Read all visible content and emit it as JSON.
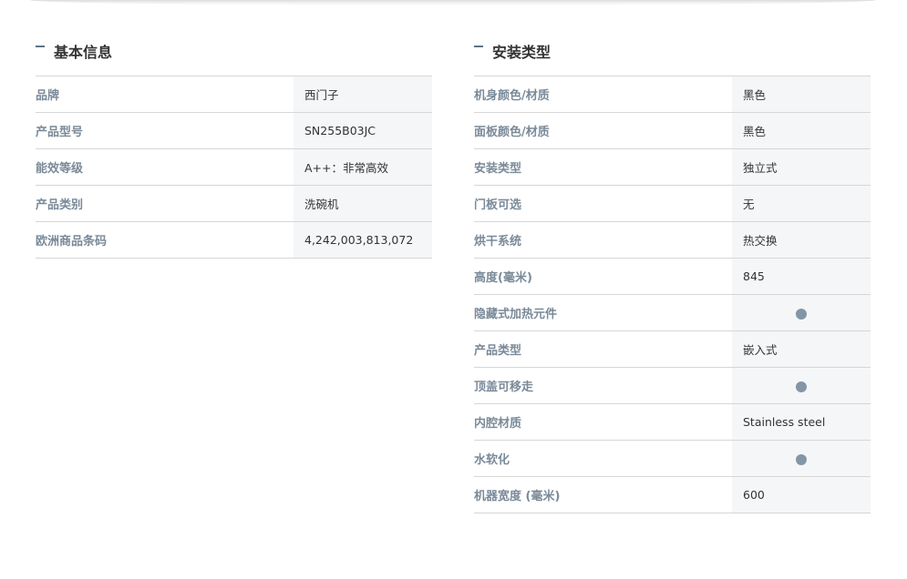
{
  "left": {
    "title": "基本信息",
    "rows": [
      {
        "label": "品牌",
        "value": "西门子"
      },
      {
        "label": "产品型号",
        "value": "SN255B03JC"
      },
      {
        "label": "能效等级",
        "value": "A++：非常高效"
      },
      {
        "label": "产品类别",
        "value": "洗碗机"
      },
      {
        "label": "欧洲商品条码",
        "value": "4,242,003,813,072"
      }
    ]
  },
  "right": {
    "title": "安装类型",
    "rows": [
      {
        "label": "机身颜色/材质",
        "value": "黑色"
      },
      {
        "label": "面板颜色/材质",
        "value": "黑色"
      },
      {
        "label": "安装类型",
        "value": "独立式"
      },
      {
        "label": "门板可选",
        "value": "无"
      },
      {
        "label": "烘干系统",
        "value": "热交换"
      },
      {
        "label": "高度(毫米)",
        "value": "845"
      },
      {
        "label": "隐藏式加热元件",
        "value": null,
        "icon": "dot-indicator-icon"
      },
      {
        "label": "产品类型",
        "value": "嵌入式"
      },
      {
        "label": "顶盖可移走",
        "value": null,
        "icon": "dot-indicator-icon"
      },
      {
        "label": "内腔材质",
        "value": "Stainless steel"
      },
      {
        "label": "水软化",
        "value": null,
        "icon": "dot-indicator-icon"
      },
      {
        "label": "机器宽度 (毫米)",
        "value": "600"
      }
    ]
  },
  "colors": {
    "label": "#7a8a98",
    "value": "#333333",
    "value_bg": "#f5f6f7",
    "divider": "#d6d6d6",
    "dot": "#8496a6",
    "title_dash": "#5f7385"
  }
}
